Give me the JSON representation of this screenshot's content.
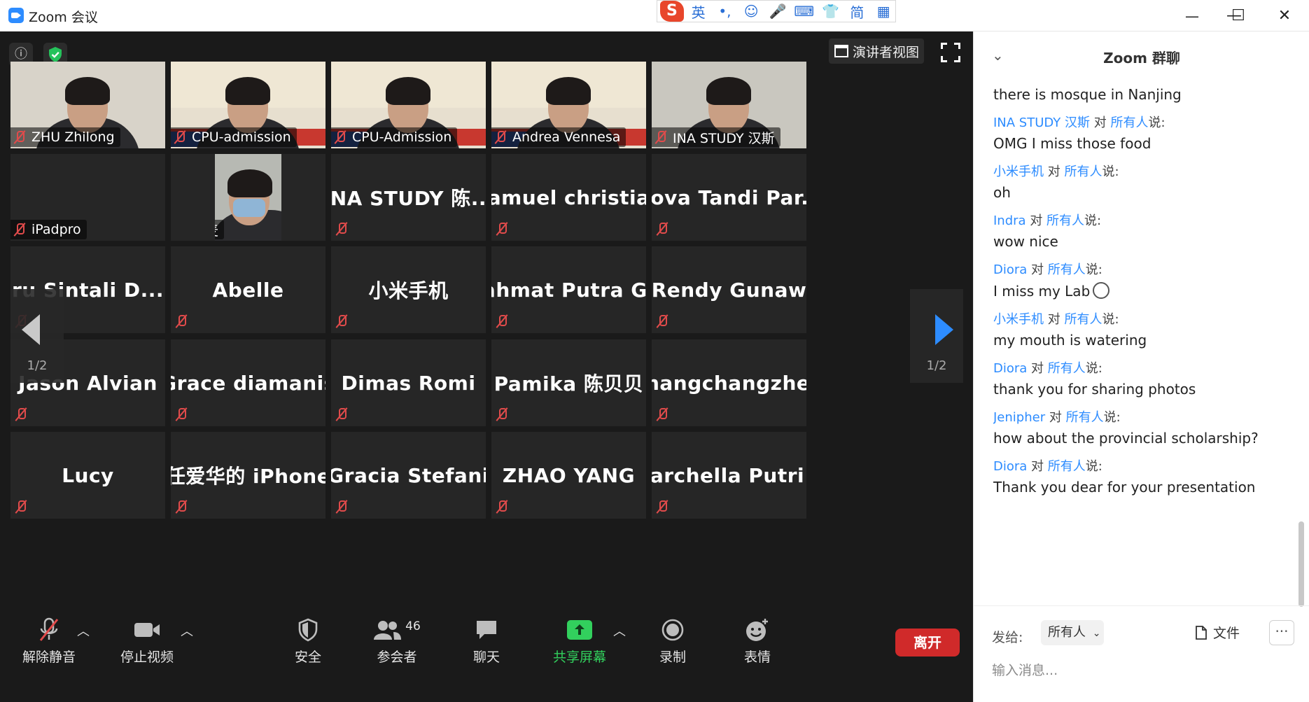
{
  "window": {
    "title": "Zoom 会议",
    "min_glyph": "—",
    "max_glyph": "☐",
    "close_glyph": "✕"
  },
  "ime": {
    "logo": "S",
    "mode": "英",
    "items": [
      "•,",
      "☺",
      "🎤",
      "⌨",
      "👕",
      "简",
      "▦"
    ]
  },
  "meeting": {
    "info_glyph": "ⓘ",
    "speaker_view": "演讲者视图",
    "tiles": [
      {
        "name": "ZHU Zhilong",
        "video": true,
        "active": false
      },
      {
        "name": "CPU-admission",
        "video": true,
        "active": false
      },
      {
        "name": "CPU-Admission",
        "video": true,
        "active": true
      },
      {
        "name": "Andrea Vennesa",
        "video": true,
        "active": false
      },
      {
        "name": "INA STUDY 汉斯",
        "video": true,
        "active": false
      },
      {
        "name": "iPadpro",
        "video": false,
        "label_only": true
      },
      {
        "name": "优麦",
        "video": true,
        "active": false
      },
      {
        "name": "INA STUDY 陈...",
        "video": false
      },
      {
        "name": "Samuel christian",
        "video": false
      },
      {
        "name": "Nova Tandi Par...",
        "video": false
      },
      {
        "name": "ru Sintali D...",
        "video": false
      },
      {
        "name": "Abelle",
        "video": false
      },
      {
        "name": "小米手机",
        "video": false
      },
      {
        "name": "Rahmat Putra G...",
        "video": false
      },
      {
        "name": "Rendy Gunaw",
        "video": false
      },
      {
        "name": "Jason Alvian",
        "video": false
      },
      {
        "name": "Grace diamanis",
        "video": false
      },
      {
        "name": "Dimas Romi",
        "video": false
      },
      {
        "name": "Pamika 陈贝贝",
        "video": false
      },
      {
        "name": "zhangchangzhen",
        "video": false
      },
      {
        "name": "Lucy",
        "video": false
      },
      {
        "name": "任爱华的 iPhone",
        "video": false
      },
      {
        "name": "Gracia Stefani",
        "video": false
      },
      {
        "name": "ZHAO YANG",
        "video": false
      },
      {
        "name": "Marchella Putri...",
        "video": false
      }
    ],
    "page_left": "1/2",
    "page_right": "1/2"
  },
  "toolbar": {
    "unmute": "解除静音",
    "stop_video": "停止视频",
    "security": "安全",
    "participants": "参会者",
    "participants_count": "46",
    "chat": "聊天",
    "share": "共享屏幕",
    "record": "录制",
    "reactions": "表情",
    "leave": "离开",
    "colors": {
      "share": "#32d05d",
      "leave": "#d02a2a",
      "accent": "#2d8cff"
    }
  },
  "chat": {
    "title": "Zoom 群聊",
    "messages": [
      {
        "from": "",
        "to": "",
        "said": "",
        "text": "there is mosque in Nanjing"
      },
      {
        "from": "INA STUDY 汉斯",
        "to": "所有人",
        "said": "说:",
        "text": "OMG I miss those food"
      },
      {
        "from": "小米手机",
        "to": "所有人",
        "said": "说:",
        "text": "oh"
      },
      {
        "from": "Indra",
        "to": "所有人",
        "said": "说:",
        "text": "wow nice"
      },
      {
        "from": "Diora",
        "to": "所有人",
        "said": "说:",
        "text": "I miss my Lab"
      },
      {
        "from": "小米手机",
        "to": "所有人",
        "said": "说:",
        "text": "my mouth is watering"
      },
      {
        "from": "Diora",
        "to": "所有人",
        "said": "说:",
        "text": "thank you for sharing photos"
      },
      {
        "from": "Jenipher",
        "to": "所有人",
        "said": "说:",
        "text": "how about the provincial scholarship?"
      },
      {
        "from": "Diora",
        "to": "所有人",
        "said": "说:",
        "text": "Thank you dear for your presentation"
      }
    ],
    "connector": "对",
    "send_to_label": "发给:",
    "recipient": "所有人",
    "file_label": "文件",
    "more_glyph": "···",
    "input_placeholder": "输入消息..."
  }
}
